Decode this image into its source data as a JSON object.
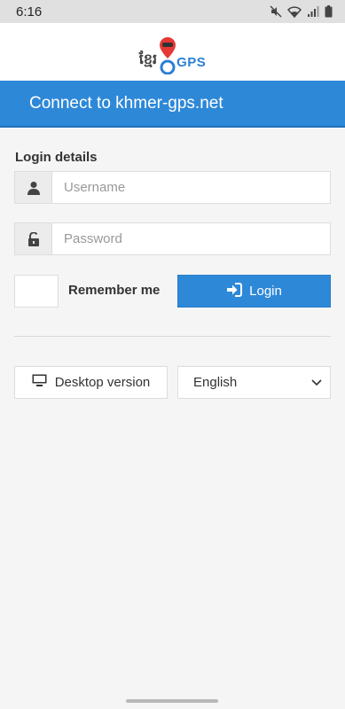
{
  "status_bar": {
    "time": "6:16",
    "icons": [
      "mute-icon",
      "wifi-icon",
      "signal-icon",
      "battery-icon"
    ]
  },
  "logo": {
    "khmer_text": "ខ្មែរ",
    "gps_text": "GPS",
    "pin_color": "#e53935",
    "gps_color": "#2b7fd6"
  },
  "header": {
    "title": "Connect to khmer-gps.net",
    "background": "#2e88d8"
  },
  "login": {
    "section_title": "Login details",
    "username_placeholder": "Username",
    "username_value": "",
    "password_placeholder": "Password",
    "password_value": "",
    "remember_label": "Remember me",
    "remember_checked": false,
    "login_button": "Login"
  },
  "footer": {
    "desktop_button": "Desktop version",
    "language_selected": "English"
  }
}
